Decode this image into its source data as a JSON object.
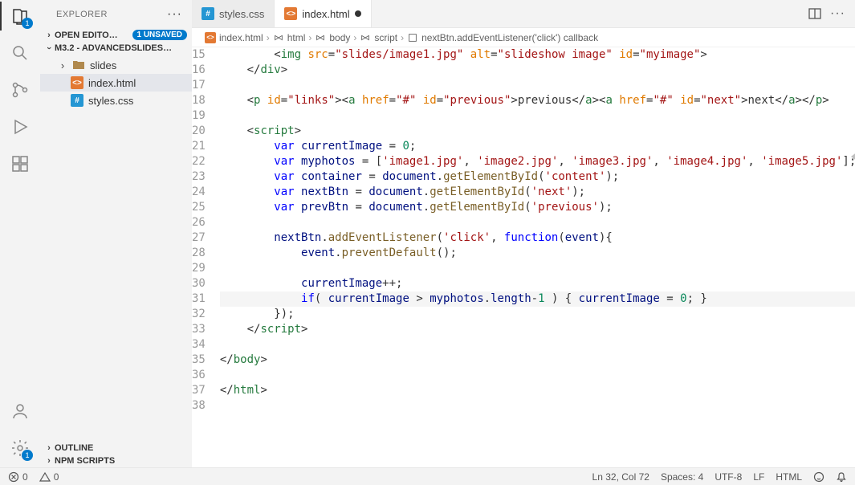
{
  "explorer": {
    "title": "EXPLORER",
    "open_editors": {
      "label": "OPEN EDITO…",
      "badge": "1 UNSAVED"
    },
    "folder": {
      "label": "M3.2 - ADVANCEDSLIDES…"
    },
    "tree": {
      "slides": "slides",
      "index_html": "index.html",
      "styles_css": "styles.css"
    },
    "outline": "OUTLINE",
    "npm": "NPM SCRIPTS"
  },
  "tabs": {
    "styles_css": "styles.css",
    "index_html": "index.html"
  },
  "breadcrumb": {
    "file": "index.html",
    "html": "html",
    "body": "body",
    "script": "script",
    "cb": "nextBtn.addEventListener('click') callback"
  },
  "status": {
    "err": "0",
    "warn": "0",
    "pos": "Ln 32, Col 72",
    "spaces": "Spaces: 4",
    "enc": "UTF-8",
    "eol": "LF",
    "lang": "HTML"
  },
  "activity_badge": {
    "explorer": "1",
    "settings": "1"
  },
  "gutter": [
    "15",
    "16",
    "17",
    "18",
    "19",
    "20",
    "21",
    "22",
    "23",
    "24",
    "25",
    "26",
    "27",
    "28",
    "29",
    "30",
    "31",
    "32",
    "33",
    "34",
    "35",
    "36",
    "37",
    "38"
  ],
  "code": [
    {
      "i": 0,
      "h": "        &lt;<span class='tok-tag'>img</span> <span class='tok-attr'>src</span>=<span class='tok-str'>\"slides/image1.jpg\"</span> <span class='tok-attr'>alt</span>=<span class='tok-str'>\"slideshow image\"</span> <span class='tok-attr'>id</span>=<span class='tok-str'>\"myimage\"</span>&gt;"
    },
    {
      "i": 1,
      "h": "    &lt;/<span class='tok-tag'>div</span>&gt;"
    },
    {
      "i": 2,
      "h": ""
    },
    {
      "i": 3,
      "h": "    &lt;<span class='tok-tag'>p</span> <span class='tok-attr'>id</span>=<span class='tok-str'>\"links\"</span>&gt;&lt;<span class='tok-tag'>a</span> <span class='tok-attr'>href</span>=<span class='tok-str'>\"#\"</span> <span class='tok-attr'>id</span>=<span class='tok-str'>\"previous\"</span>&gt;previous&lt;/<span class='tok-tag'>a</span>&gt;&lt;<span class='tok-tag'>a</span> <span class='tok-attr'>href</span>=<span class='tok-str'>\"#\"</span> <span class='tok-attr'>id</span>=<span class='tok-str'>\"next\"</span>&gt;next&lt;/<span class='tok-tag'>a</span>&gt;&lt;/<span class='tok-tag'>p</span>&gt;"
    },
    {
      "i": 4,
      "h": ""
    },
    {
      "i": 5,
      "h": "    &lt;<span class='tok-tag'>script</span>&gt;"
    },
    {
      "i": 6,
      "h": "        <span class='tok-kw'>var</span> <span class='tok-prop'>currentImage</span> = <span class='tok-num'>0</span>;"
    },
    {
      "i": 7,
      "h": "        <span class='tok-kw'>var</span> <span class='tok-prop'>myphotos</span> = [<span class='tok-str'>'image1.jpg'</span>, <span class='tok-str'>'image2.jpg'</span>, <span class='tok-str'>'image3.jpg'</span>, <span class='tok-str'>'image4.jpg'</span>, <span class='tok-str'>'image5.jpg'</span>];"
    },
    {
      "i": 8,
      "h": "        <span class='tok-kw'>var</span> <span class='tok-prop'>container</span> = <span class='tok-prop'>document</span>.<span class='tok-fn'>getElementById</span>(<span class='tok-str'>'content'</span>);"
    },
    {
      "i": 9,
      "h": "        <span class='tok-kw'>var</span> <span class='tok-prop'>nextBtn</span> = <span class='tok-prop'>document</span>.<span class='tok-fn'>getElementById</span>(<span class='tok-str'>'next'</span>);"
    },
    {
      "i": 10,
      "h": "        <span class='tok-kw'>var</span> <span class='tok-prop'>prevBtn</span> = <span class='tok-prop'>document</span>.<span class='tok-fn'>getElementById</span>(<span class='tok-str'>'previous'</span>);"
    },
    {
      "i": 11,
      "h": ""
    },
    {
      "i": 12,
      "h": "        <span class='tok-prop'>nextBtn</span>.<span class='tok-fn'>addEventListener</span>(<span class='tok-str'>'click'</span>, <span class='tok-kw'>function</span>(<span class='tok-prop'>event</span>){"
    },
    {
      "i": 13,
      "h": "            <span class='tok-prop'>event</span>.<span class='tok-fn'>preventDefault</span>();"
    },
    {
      "i": 14,
      "h": ""
    },
    {
      "i": 15,
      "h": "            <span class='tok-prop'>currentImage</span>++;"
    },
    {
      "i": 16,
      "hl": true,
      "h": "            <span class='tok-kw'>if</span>( <span class='tok-prop'>currentImage</span> &gt; <span class='tok-prop'>myphotos</span>.<span class='tok-prop'>length</span>-<span class='tok-num'>1</span> ) { <span class='tok-prop'>currentImage</span> = <span class='tok-num'>0</span>; }"
    },
    {
      "i": 17,
      "h": "        });"
    },
    {
      "i": 18,
      "h": "    &lt;/<span class='tok-tag'>script</span>&gt;"
    },
    {
      "i": 19,
      "h": ""
    },
    {
      "i": 20,
      "h": "&lt;/<span class='tok-tag'>body</span>&gt;"
    },
    {
      "i": 21,
      "h": ""
    },
    {
      "i": 22,
      "h": "&lt;/<span class='tok-tag'>html</span>&gt;"
    }
  ]
}
